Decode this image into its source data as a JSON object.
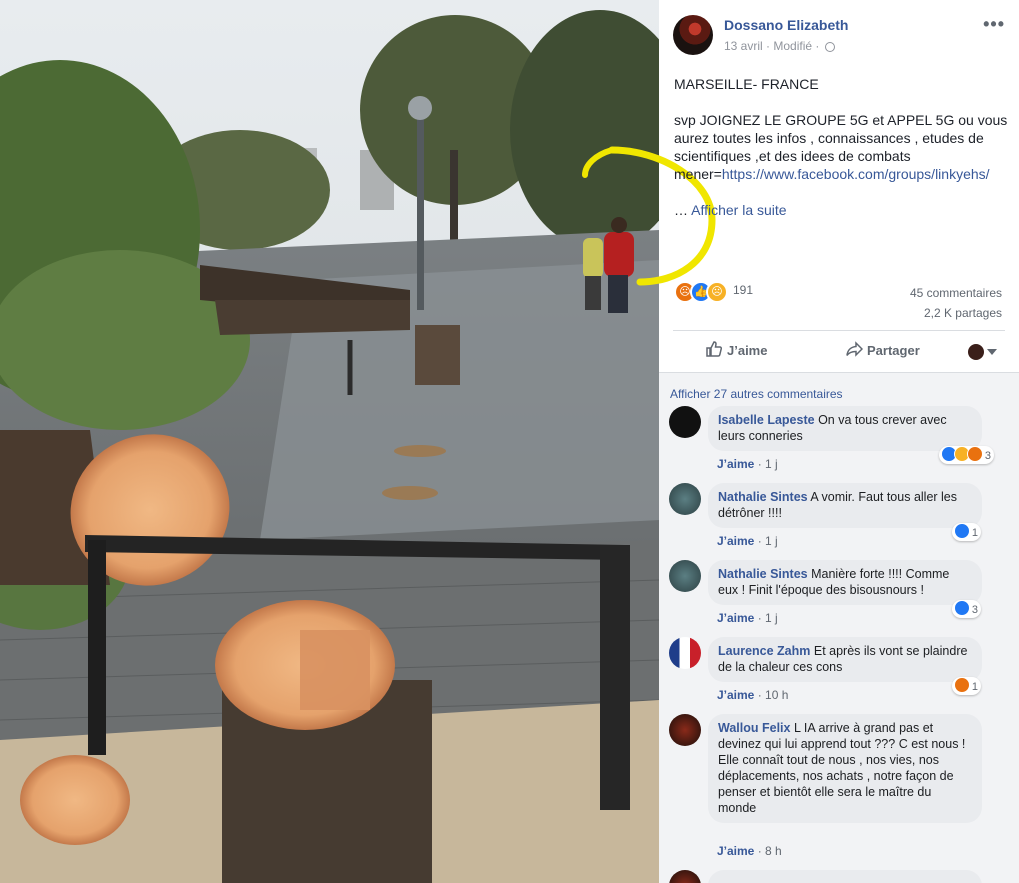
{
  "post": {
    "author": "Dossano Elizabeth",
    "date": "13 avril",
    "modified": "Modifié",
    "more_icon": "more-horizontal-icon",
    "text_line1": "MARSEILLE- FRANCE",
    "text_body": "svp JOIGNEZ LE GROUPE 5G et APPEL 5G ou vous aurez toutes les infos , connaissances , etudes de scientifiques ,et des idees de combats mener=",
    "link": "https://www.facebook.com/groups/linkyehs/",
    "see_more_prefix": "…",
    "see_more": "Afficher la suite",
    "reaction_count": "191",
    "comments_count": "45 commentaires",
    "shares_count": "2,2 K partages"
  },
  "actions": {
    "like": "J’aime",
    "share": "Partager"
  },
  "comments_header": "Afficher 27 autres commentaires",
  "comments": [
    {
      "name": "Isabelle Lapeste",
      "text": "On va tous crever avec leurs conneries",
      "like": "J’aime",
      "time": "1 j",
      "reacts": "3"
    },
    {
      "name": "Nathalie Sintes",
      "text": "A vomir. Faut tous aller les détrôner !!!!",
      "like": "J’aime",
      "time": "1 j",
      "reacts": "1"
    },
    {
      "name": "Nathalie Sintes",
      "text": "Manière forte !!!! Comme eux ! Finit l'époque des bisousnours !",
      "like": "J’aime",
      "time": "1 j",
      "reacts": "3"
    },
    {
      "name": "Laurence Zahm",
      "text": "Et après ils vont se plaindre de la chaleur ces cons",
      "like": "J’aime",
      "time": "10 h",
      "reacts": "1"
    },
    {
      "name": "Wallou Felix",
      "text": "L IA arrive à grand pas et devinez qui lui apprend tout ??? C est nous !",
      "text2": "Elle connaît tout de nous , nos vies, nos déplacements, nos achats , notre façon de penser et bientôt elle sera le maître du monde",
      "like": "J’aime",
      "time": "8 h"
    }
  ],
  "colors": {
    "link": "#385898",
    "meta": "#90949c",
    "bubble": "#e9ebee",
    "annotation": "#f0e600"
  }
}
